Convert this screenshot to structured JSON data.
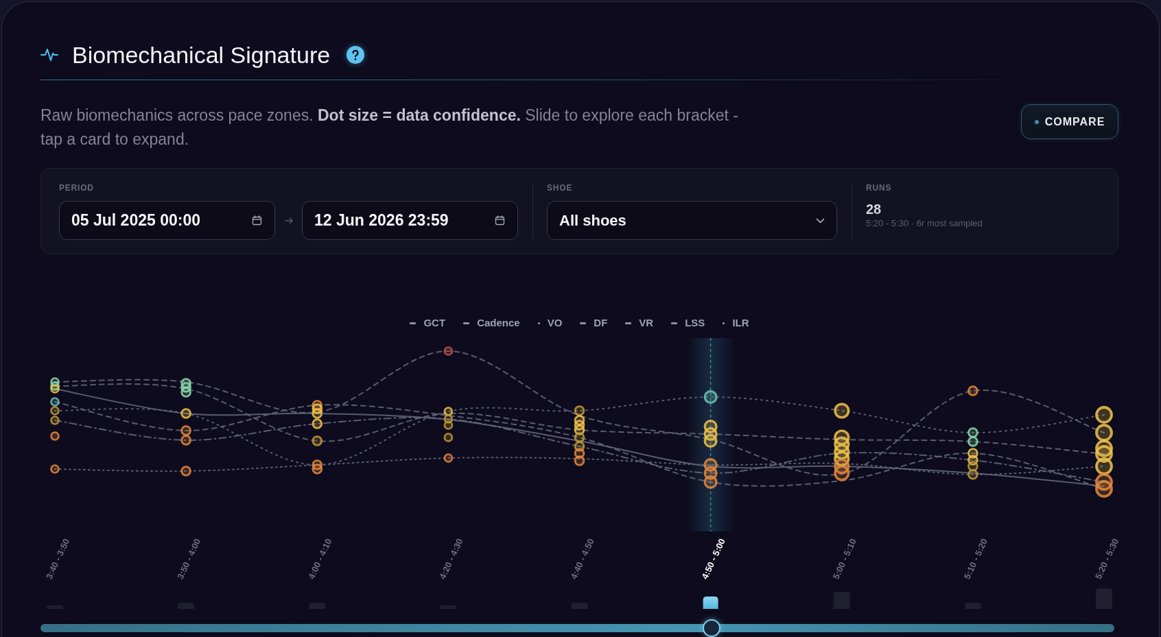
{
  "header": {
    "title": "Biomechanical Signature"
  },
  "description": "Raw biomechanics across pace zones. **Dot size = data confidence.** Slide to explore each bracket - tap a card to expand.",
  "compare_button": {
    "label": "COMPARE"
  },
  "filters": {
    "period": {
      "label": "PERIOD",
      "start": "05 Jul 2025 00:00",
      "end": "12 Jun 2026 23:59"
    },
    "shoe": {
      "label": "SHOE",
      "value": "All shoes"
    },
    "runs": {
      "label": "RUNS",
      "value": "28",
      "note": "5:20 - 5:30 · 6r most sampled"
    }
  },
  "chart": {
    "legend": [
      {
        "label": "GCT",
        "kind": "dash"
      },
      {
        "label": "Cadence",
        "kind": "dash"
      },
      {
        "label": "VO",
        "kind": "dot"
      },
      {
        "label": "DF",
        "kind": "dash"
      },
      {
        "label": "VR",
        "kind": "dash"
      },
      {
        "label": "LSS",
        "kind": "dash"
      },
      {
        "label": "ILR",
        "kind": "dot"
      }
    ],
    "brackets": [
      {
        "label": "3:40 - 3:50",
        "selected": false
      },
      {
        "label": "3:50 - 4:00",
        "selected": false
      },
      {
        "label": "4:00 - 4:10",
        "selected": false
      },
      {
        "label": "4:20 - 4:30",
        "selected": false
      },
      {
        "label": "4:40 - 4:50",
        "selected": false
      },
      {
        "label": "4:50 - 5:00",
        "selected": true
      },
      {
        "label": "5:00 - 5:10",
        "selected": false
      },
      {
        "label": "5:10 - 5:20",
        "selected": false
      },
      {
        "label": "5:20 - 5:30",
        "selected": false
      }
    ]
  },
  "pace_slider": {
    "level": 0.625
  }
}
